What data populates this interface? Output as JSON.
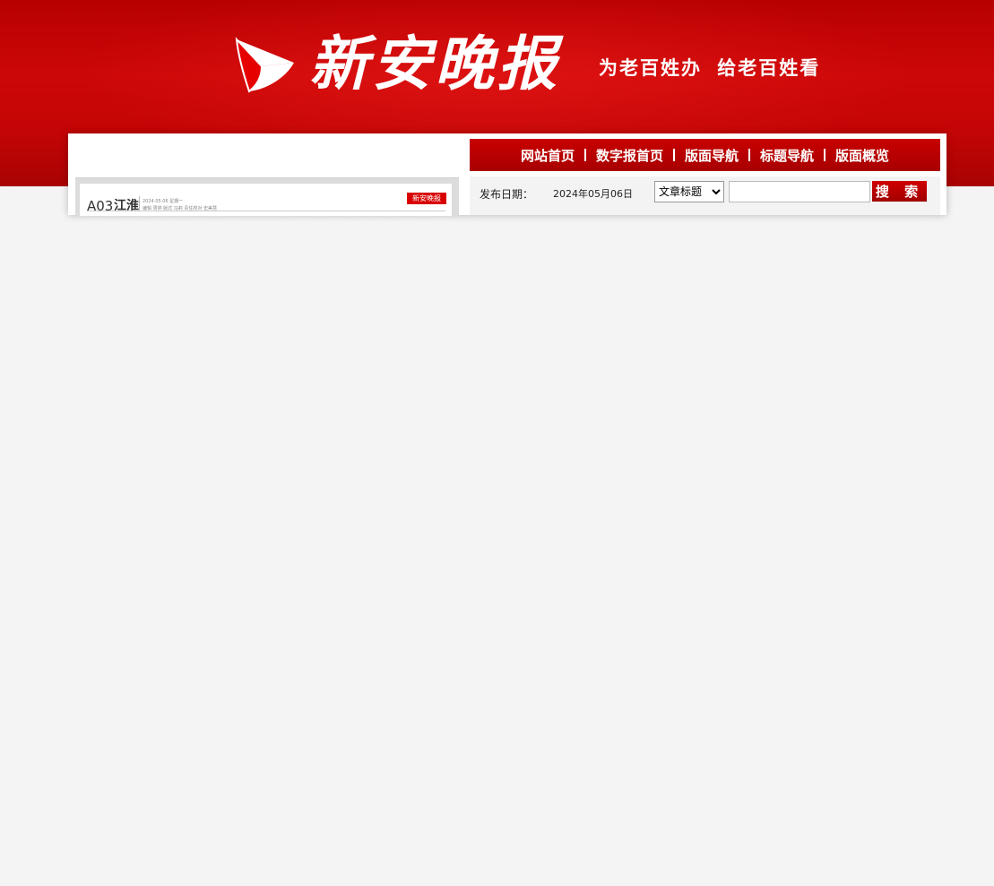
{
  "header": {
    "logo_text": "新安晚报",
    "slogan": "为老百姓办 给老百姓看"
  },
  "nav": {
    "items": [
      {
        "label": "网站首页"
      },
      {
        "label": "数字报首页"
      },
      {
        "label": "版面导航"
      },
      {
        "label": "标题导航"
      },
      {
        "label": "版面概览"
      }
    ]
  },
  "search": {
    "date_label": "发布日期：",
    "date_value": "2024年05月06日",
    "field_selected": "文章标题",
    "input_value": "",
    "button_label": "搜 索"
  },
  "paper": {
    "page_code": "A03",
    "page_section": "江淮",
    "meta_line1": "2024.05.06 星期一",
    "meta_line2": "编辑 周婷   版式 冯莉   责任校对 史美慧",
    "corner_logo": "新安晚报"
  },
  "colors": {
    "brand_red": "#c40505",
    "nav_red": "#b80000"
  }
}
